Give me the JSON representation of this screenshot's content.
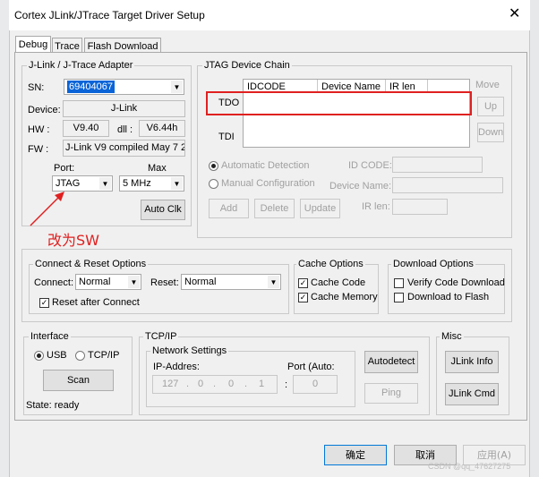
{
  "window": {
    "title": "Cortex JLink/JTrace Target Driver Setup",
    "close": "✕"
  },
  "tabs": [
    "Debug",
    "Trace",
    "Flash Download"
  ],
  "adapter": {
    "title": "J-Link / J-Trace Adapter",
    "sn_label": "SN:",
    "sn_value": "69404067",
    "device_label": "Device:",
    "device_value": "J-Link",
    "hw_label": "HW :",
    "hw_value": "V9.40",
    "dll_label": "dll :",
    "dll_value": "V6.44h",
    "fw_label": "FW :",
    "fw_value": "J-Link V9 compiled May  7 2",
    "port_label": "Port:",
    "port_value": "JTAG",
    "max_label": "Max",
    "max_value": "5 MHz",
    "autoclk": "Auto Clk"
  },
  "jtag": {
    "title": "JTAG Device Chain",
    "col_idcode": "IDCODE",
    "col_devname": "Device Name",
    "col_irlen": "IR len",
    "move_label": "Move",
    "tdo": "TDO",
    "tdi": "TDI",
    "up": "Up",
    "down": "Down",
    "auto_detect": "Automatic Detection",
    "manual_config": "Manual Configuration",
    "id_code_label": "ID CODE:",
    "device_name_label": "Device Name:",
    "ir_len_label": "IR len:",
    "add": "Add",
    "delete": "Delete",
    "update": "Update"
  },
  "annotation": {
    "text": "改为SW",
    "color": "#e02020"
  },
  "connect": {
    "title": "Connect & Reset Options",
    "connect_label": "Connect:",
    "connect_value": "Normal",
    "reset_label": "Reset:",
    "reset_value": "Normal",
    "reset_after": "Reset after Connect"
  },
  "cache": {
    "title": "Cache Options",
    "code": "Cache Code",
    "memory": "Cache Memory"
  },
  "download": {
    "title": "Download Options",
    "verify": "Verify Code Download",
    "flash": "Download to Flash"
  },
  "interface": {
    "title": "Interface",
    "usb": "USB",
    "tcpip": "TCP/IP",
    "scan": "Scan",
    "state": "State: ready"
  },
  "tcp": {
    "title": "TCP/IP",
    "network": "Network Settings",
    "ip_label": "IP-Addres:",
    "ip": [
      "127",
      "0",
      "0",
      "1"
    ],
    "port_label": "Port (Auto:",
    "port_value": "0",
    "autodetect": "Autodetect",
    "ping": "Ping"
  },
  "misc": {
    "title": "Misc",
    "jlink_info": "JLink Info",
    "jlink_cmd": "JLink Cmd"
  },
  "footer": {
    "ok": "确定",
    "cancel": "取消",
    "apply": "应用(A)"
  },
  "watermark": "CSDN @qq_47627275"
}
